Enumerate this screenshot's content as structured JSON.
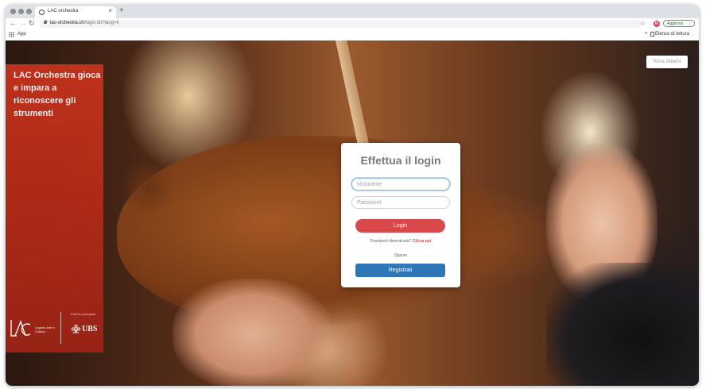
{
  "browser": {
    "tab_title": "LAC orchestra",
    "tab_close": "×",
    "new_tab": "+",
    "url_domain": "lac-orchestra.ch",
    "url_path": "/login.do?lang=it",
    "profile_initial": "M",
    "update_label": "Aggiorna",
    "update_dots": "⋮",
    "apps_label": "App",
    "reading_list_label": "Elenco di lettura",
    "reading_chevron": "»",
    "back_arrow": "←",
    "forward_arrow": "→",
    "reload": "↻",
    "star": "☆"
  },
  "page": {
    "panel": {
      "headline": "LAC Orchestra gioca e impara a riconoscere gli strumenti",
      "lac_logo_text": "Lugano Arte e Cultura",
      "partner_label": "Partner principale",
      "ubs_label": "UBS"
    },
    "back_button_label": "Torna indietro",
    "login": {
      "title": "Effettua il login",
      "nickname_placeholder": "Nickname",
      "password_placeholder": "Password",
      "login_button": "Login",
      "forgot_text": "Password dimenticata?",
      "forgot_link": "Clicca qui",
      "or_text": "Oppure",
      "register_button": "Registrati"
    }
  },
  "colors": {
    "panel_red": "#c9341e",
    "login_red": "#d9484a",
    "register_blue": "#2f76b7"
  }
}
